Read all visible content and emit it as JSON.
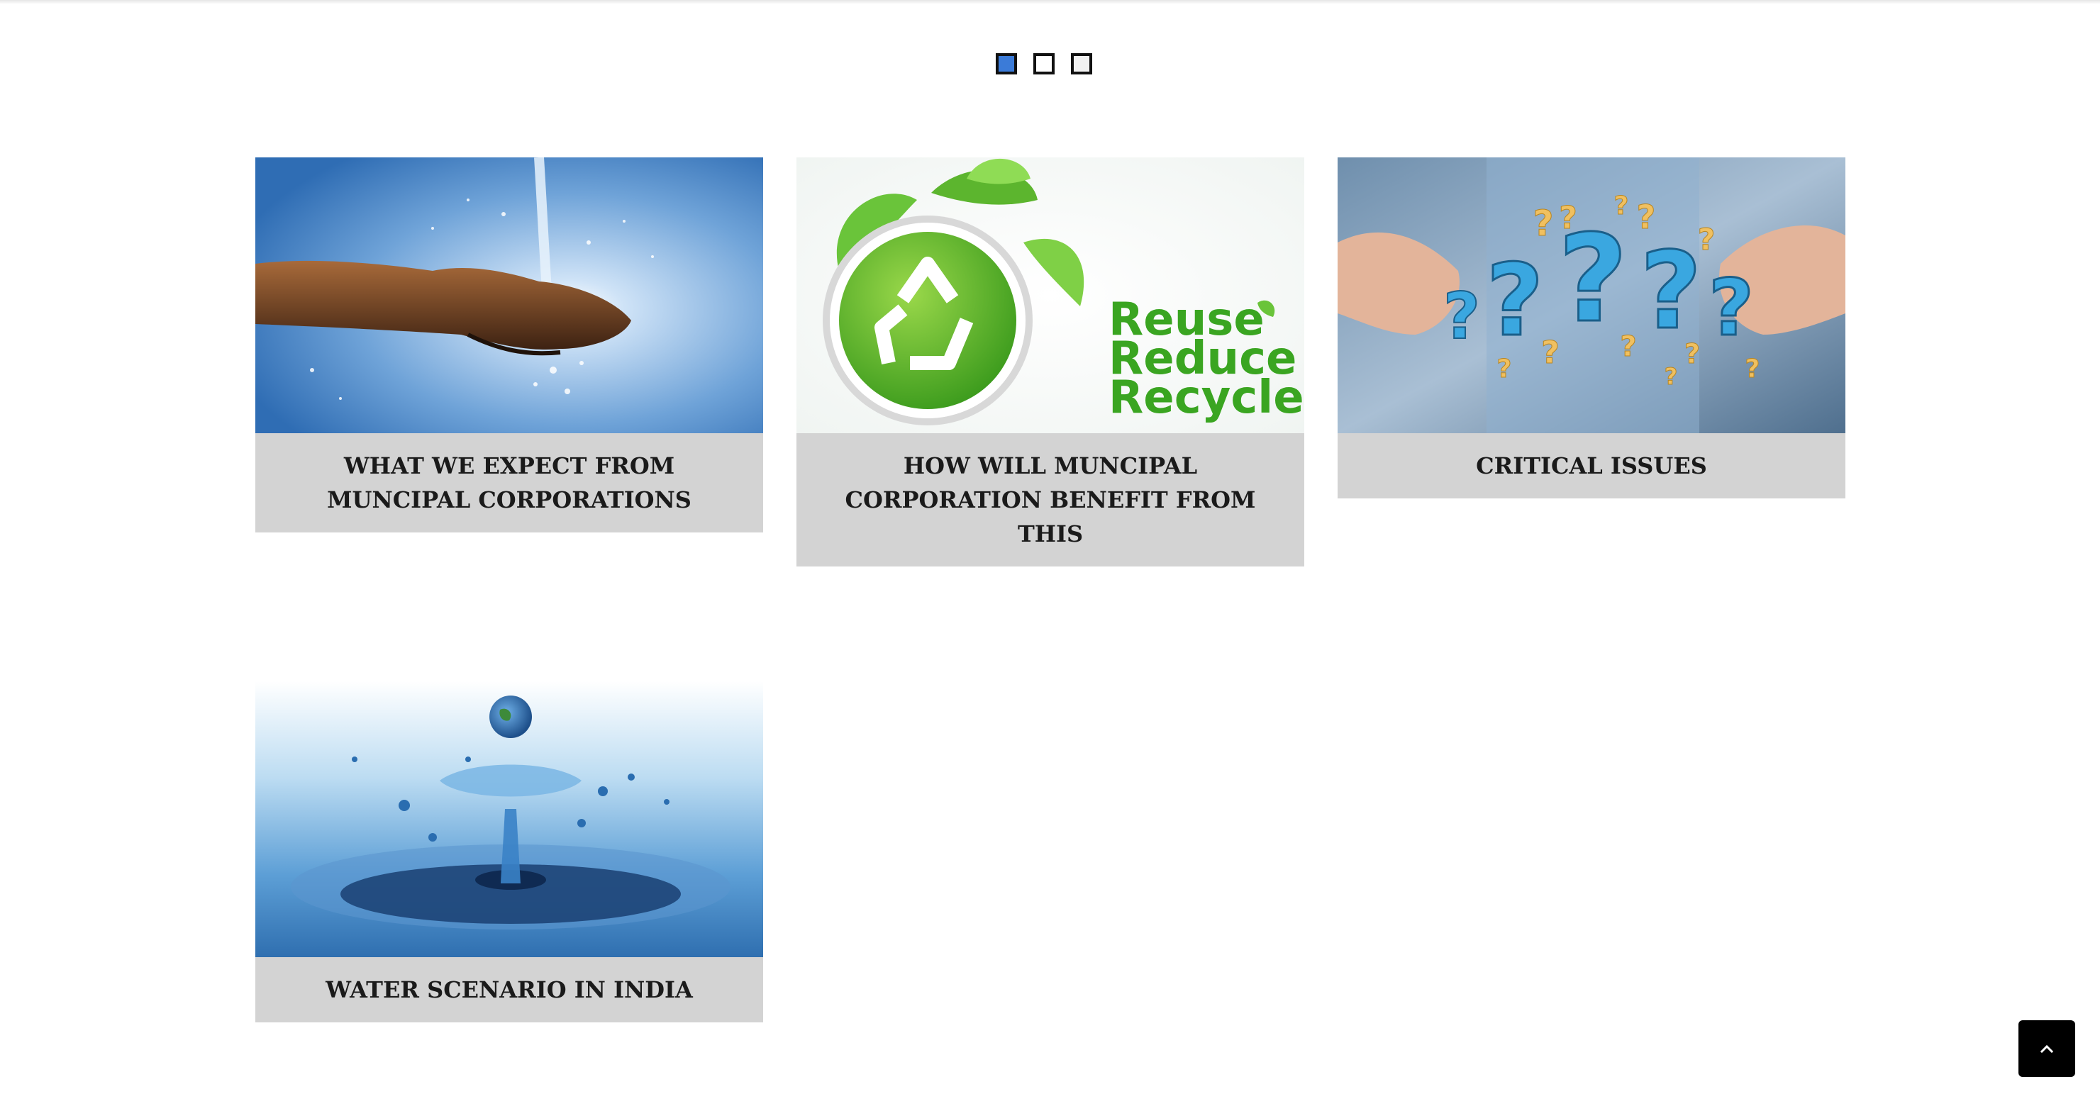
{
  "carousel": {
    "dots": [
      {
        "state": "active",
        "color": "#3b7bd8"
      },
      {
        "state": "inactive",
        "color": "#ffffff"
      },
      {
        "state": "inactive",
        "color": "#f2f2f2"
      }
    ]
  },
  "cards": [
    {
      "title": "WHAT WE EXPECT FROM MUNCIPAL CORPORATIONS",
      "image": "water-in-hand-photo"
    },
    {
      "title": "HOW WILL MUNCIPAL CORPORATION BENEFIT FROM THIS",
      "image": "recycle-logo-graphic",
      "image_text": "Reuse Reduce Recycle"
    },
    {
      "title": "CRITICAL ISSUES",
      "image": "question-marks-hands-photo"
    },
    {
      "title": "WATER SCENARIO IN INDIA",
      "image": "water-drop-earth-photo"
    }
  ],
  "back_to_top": {
    "icon": "chevron-up-icon"
  },
  "colors": {
    "card_bg": "#d3d3d3",
    "accent": "#3b7bd8",
    "button_bg": "#000000"
  }
}
